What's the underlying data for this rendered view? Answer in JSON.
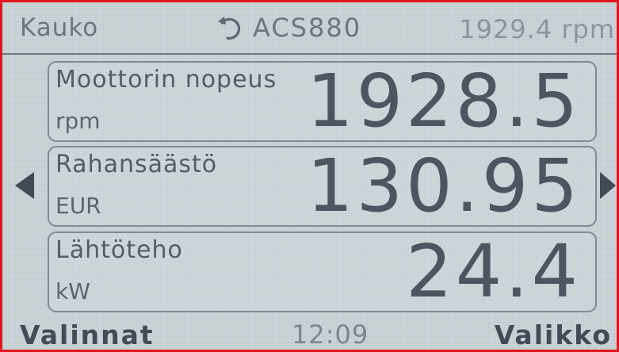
{
  "status": {
    "control_mode": "Kauko",
    "rotation_icon": "rotate-clockwise-icon",
    "drive_name": "ACS880",
    "actual_value": "1929.4 rpm"
  },
  "panels": [
    {
      "name": "Moottorin nopeus",
      "unit": "rpm",
      "value": "1928.5"
    },
    {
      "name": "Rahansäästö",
      "unit": "EUR",
      "value": "130.95"
    },
    {
      "name": "Lähtöteho",
      "unit": "kW",
      "value": "24.4"
    }
  ],
  "navigation": {
    "left_icon": "triangle-left-icon",
    "right_icon": "triangle-right-icon"
  },
  "softkeys": {
    "left_label": "Valinnat",
    "time": "12:09",
    "right_label": "Valikko"
  },
  "colors": {
    "frame": "#e0161c",
    "background": "#ccd4d8",
    "text": "#4f5a64"
  }
}
